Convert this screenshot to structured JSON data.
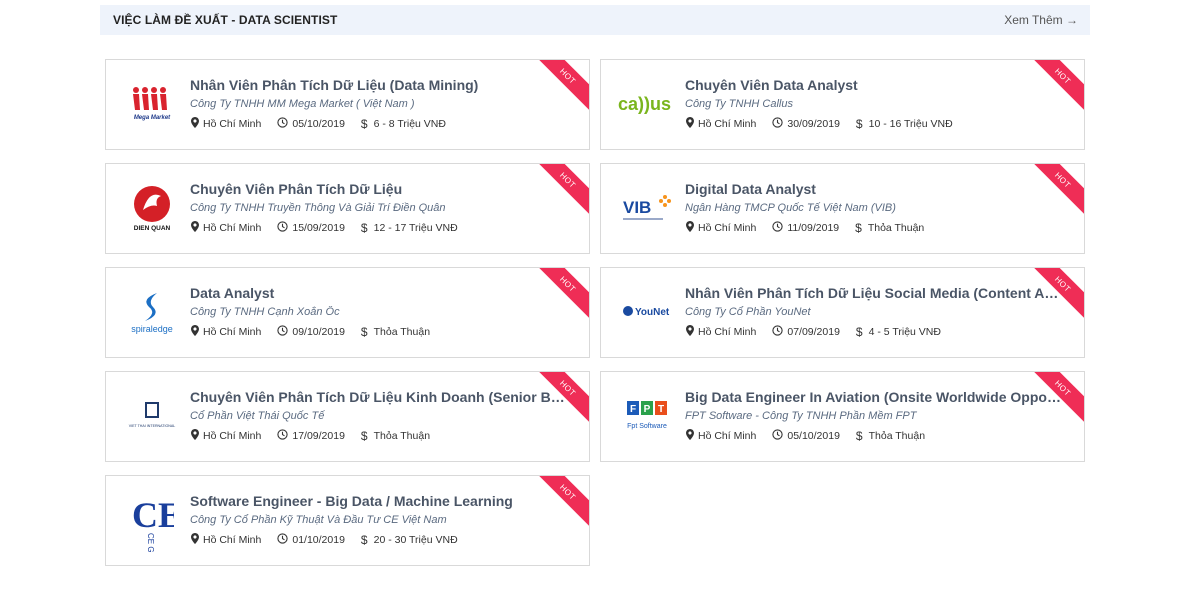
{
  "section": {
    "title": "VIỆC LÀM ĐỀ XUẤT - DATA SCIENTIST",
    "more_label": "Xem Thêm →"
  },
  "hot_label": "HOT",
  "jobs": [
    {
      "title": "Nhân Viên Phân Tích Dữ Liệu (Data Mining)",
      "company": "Công Ty TNHH MM Mega Market ( Việt Nam )",
      "location": "Hồ Chí Minh",
      "date": "05/10/2019",
      "salary": "6 - 8 Triệu VNĐ",
      "logo": "mm-mega-market-logo",
      "logo_text": "Mega Market"
    },
    {
      "title": "Chuyên Viên Data Analyst",
      "company": "Công Ty TNHH Callus",
      "location": "Hồ Chí Minh",
      "date": "30/09/2019",
      "salary": "10 - 16 Triệu VNĐ",
      "logo": "callus-logo",
      "logo_text": "ca))us"
    },
    {
      "title": "Chuyên Viên Phân Tích Dữ Liệu",
      "company": "Công Ty TNHH Truyền Thông Và Giải Trí Điền Quân",
      "location": "Hồ Chí Minh",
      "date": "15/09/2019",
      "salary": "12 - 17 Triệu VNĐ",
      "logo": "dien-quan-logo",
      "logo_text": "DIEN QUAN"
    },
    {
      "title": "Digital Data Analyst",
      "company": "Ngân Hàng TMCP Quốc Tế Việt Nam (VIB)",
      "location": "Hồ Chí Minh",
      "date": "11/09/2019",
      "salary": "Thỏa Thuận",
      "logo": "vib-logo",
      "logo_text": "VIB"
    },
    {
      "title": "Data Analyst",
      "company": "Công Ty TNHH Cạnh Xoắn Ốc",
      "location": "Hồ Chí Minh",
      "date": "09/10/2019",
      "salary": "Thỏa Thuận",
      "logo": "spiraledge-logo",
      "logo_text": "spiraledge"
    },
    {
      "title": "Nhân Viên Phân Tích Dữ Liệu Social Media (Content Analyst)",
      "company": "Công Ty Cổ Phần YouNet",
      "location": "Hồ Chí Minh",
      "date": "07/09/2019",
      "salary": "4 - 5 Triệu VNĐ",
      "logo": "younet-logo",
      "logo_text": "YouNet"
    },
    {
      "title": "Chuyên Viên Phân Tích Dữ Liệu Kinh Doanh (Senior Business Analyst)",
      "company": "Cổ Phần Việt Thái Quốc Tế",
      "location": "Hồ Chí Minh",
      "date": "17/09/2019",
      "salary": "Thỏa Thuận",
      "logo": "viet-thai-logo",
      "logo_text": "VIET THAI INTERNATIONAL"
    },
    {
      "title": "Big Data Engineer In Aviation (Onsite Worldwide Opportunities)",
      "company": "FPT Software - Công Ty TNHH Phần Mềm FPT",
      "location": "Hồ Chí Minh",
      "date": "05/10/2019",
      "salary": "Thỏa Thuận",
      "logo": "fpt-software-logo",
      "logo_text": "Fpt Software"
    },
    {
      "title": "Software Engineer - Big Data / Machine Learning",
      "company": "Công Ty Cổ Phần Kỹ Thuật Và Đầu Tư CE Việt Nam",
      "location": "Hồ Chí Minh",
      "date": "01/10/2019",
      "salary": "20 - 30 Triệu VNĐ",
      "logo": "ce-group-logo",
      "logo_text": "CE Group"
    }
  ],
  "colors": {
    "header_bg": "#eef3fb",
    "title": "#4a5566",
    "company": "#5a6a80",
    "hot_ribbon": "#ef2d56",
    "card_border": "#d9d9d9"
  }
}
